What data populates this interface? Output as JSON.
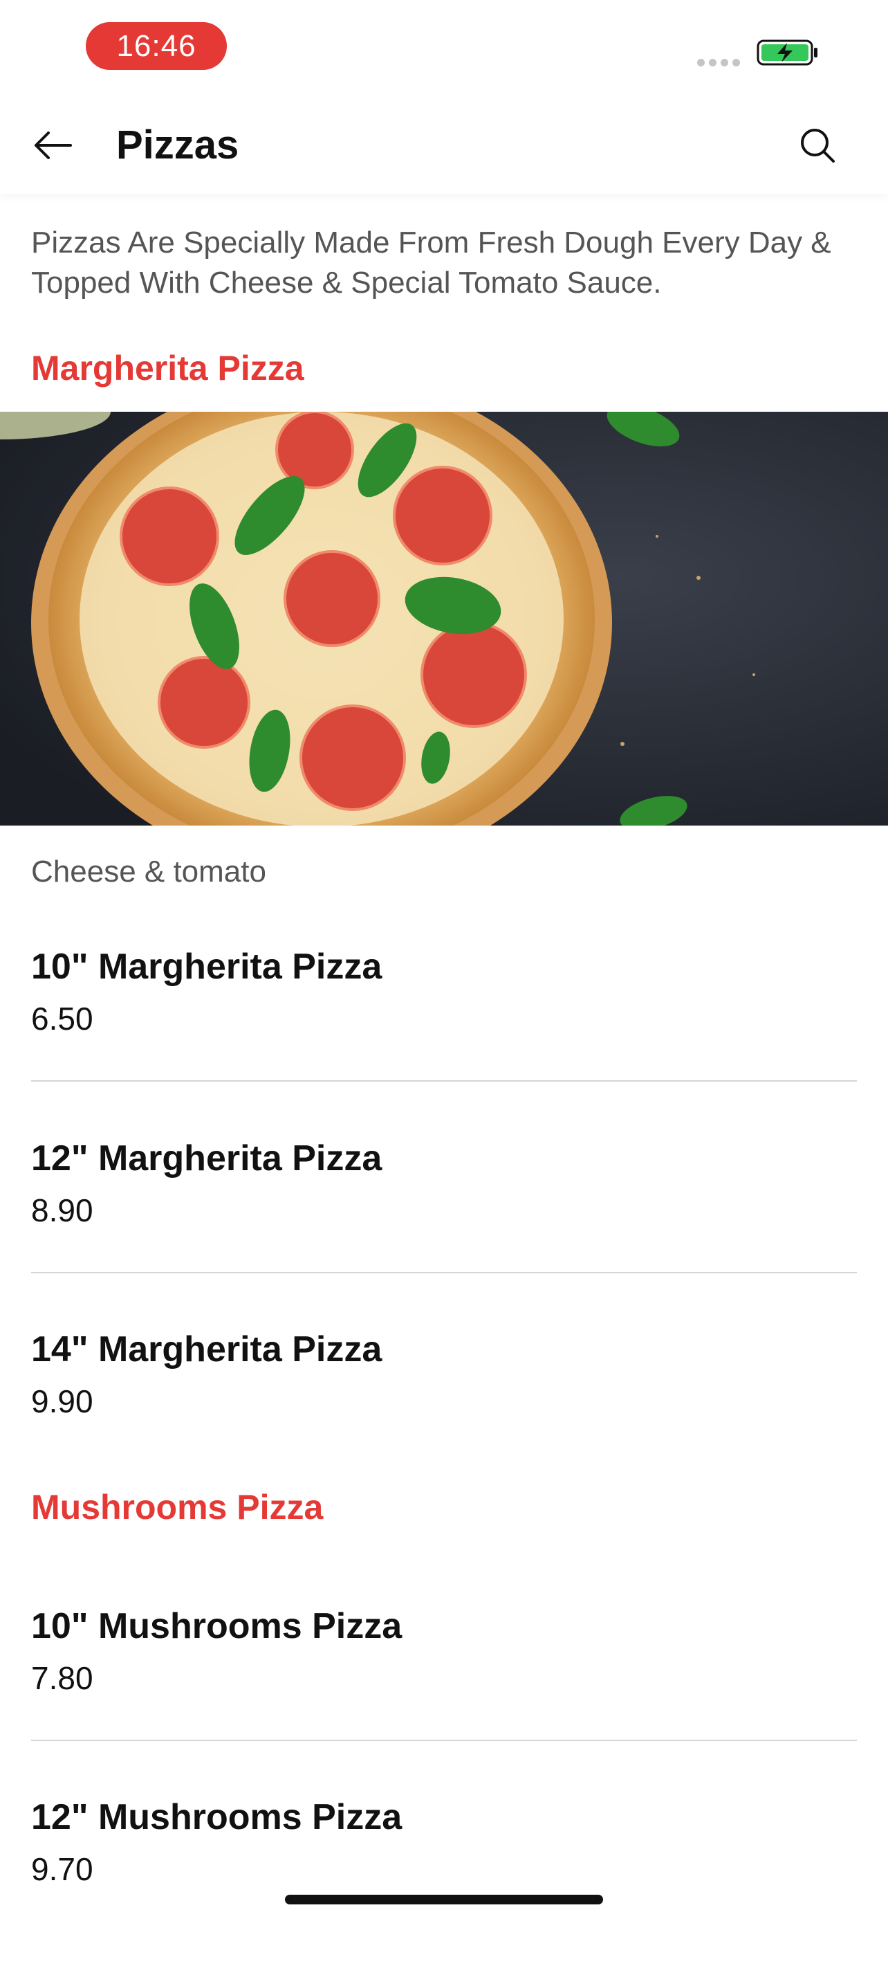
{
  "status_bar": {
    "time": "16:46",
    "time_pill_color": "#e53935",
    "battery_icon": "battery-charging-icon",
    "battery_color": "#34c759"
  },
  "app_bar": {
    "title": "Pizzas",
    "back_icon": "arrow-left-icon",
    "search_icon": "search-icon"
  },
  "category": {
    "description": "Pizzas Are Specially Made From Fresh Dough Every Day & Topped With Cheese & Special Tomato Sauce."
  },
  "sections": [
    {
      "title": "Margherita Pizza",
      "subtitle": "Cheese & tomato",
      "items": [
        {
          "name": "10\" Margherita Pizza",
          "price": "6.50"
        },
        {
          "name": "12\" Margherita Pizza",
          "price": "8.90"
        },
        {
          "name": "14\" Margherita Pizza",
          "price": "9.90"
        }
      ]
    },
    {
      "title": "Mushrooms Pizza",
      "items": [
        {
          "name": "10\" Mushrooms Pizza",
          "price": "7.80"
        },
        {
          "name": "12\" Mushrooms Pizza",
          "price": "9.70"
        }
      ]
    }
  ],
  "colors": {
    "accent": "#e53935",
    "text": "#111111",
    "muted_text": "#555555",
    "divider": "#d6d6d6"
  }
}
